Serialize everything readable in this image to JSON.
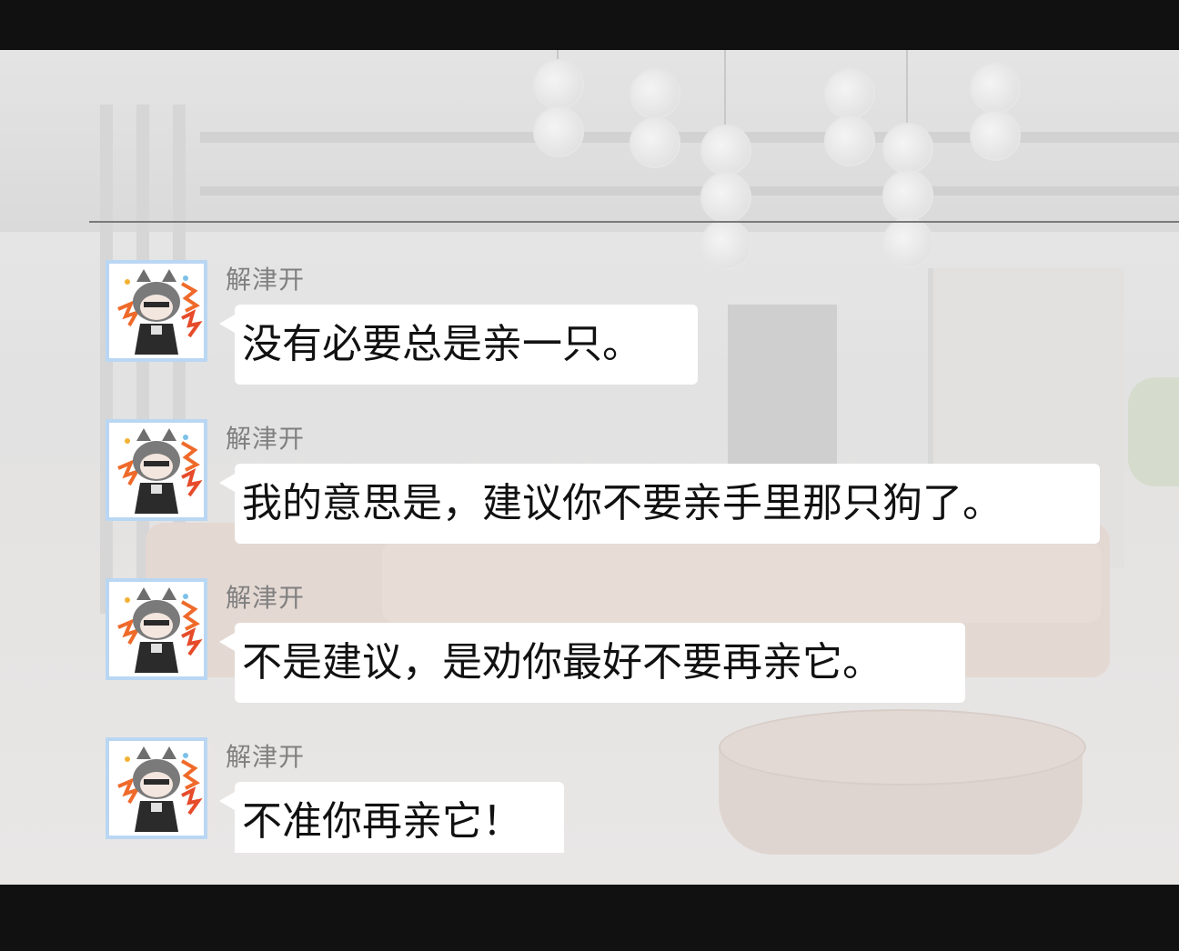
{
  "chat": {
    "messages": [
      {
        "sender": "解津开",
        "text": "没有必要总是亲一只。"
      },
      {
        "sender": "解津开",
        "text": "我的意思是，建议你不要亲手里那只狗了。"
      },
      {
        "sender": "解津开",
        "text": "不是建议，是劝你最好不要再亲它。"
      },
      {
        "sender": "解津开",
        "text": "不准你再亲它！"
      }
    ]
  },
  "theme": {
    "bubble_color": "#ffffff",
    "avatar_border": "#b9d7f3",
    "sender_color": "#808080",
    "letterbox_color": "#111111"
  },
  "icons": {
    "avatar": "wolf-avatar-icon"
  }
}
